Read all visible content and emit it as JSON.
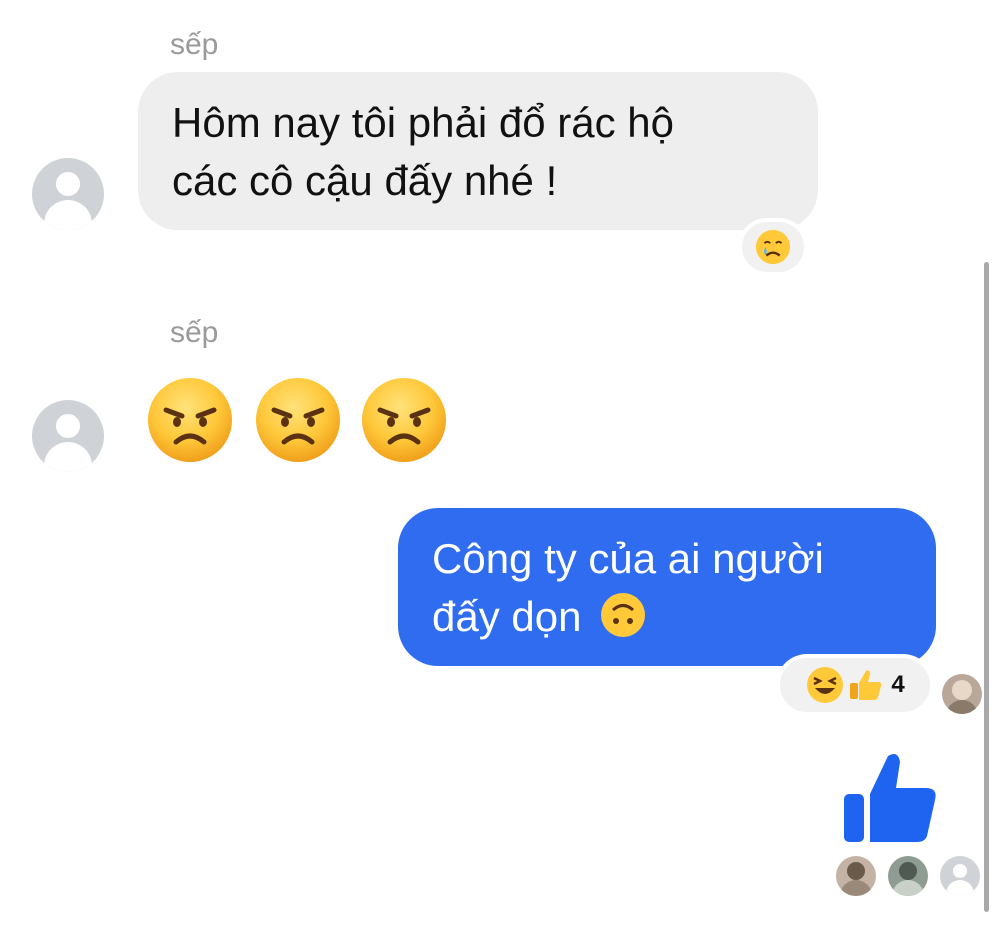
{
  "messages": [
    {
      "sender": "sếp",
      "lines": [
        "Hôm nay tôi phải đổ rác hộ",
        "các cô cậu đấy nhé !"
      ],
      "reaction": "crying-face"
    },
    {
      "sender": "sếp",
      "emojis": [
        "angry-face",
        "angry-face",
        "angry-face"
      ]
    },
    {
      "text_line1": "Công ty của ai người",
      "text_line2": "đấy dọn",
      "inline_emoji": "upside-down-face",
      "reactions": [
        "laughing-face",
        "thumbs-up"
      ],
      "reaction_count": "4"
    },
    {
      "type": "like-sticker",
      "icon": "thumbs-up"
    }
  ],
  "colors": {
    "outgoing_bubble": "#2f6cf0",
    "incoming_bubble": "#eeeeef",
    "sender_name": "#9a9a9a",
    "like_blue": "#1f64f0"
  }
}
